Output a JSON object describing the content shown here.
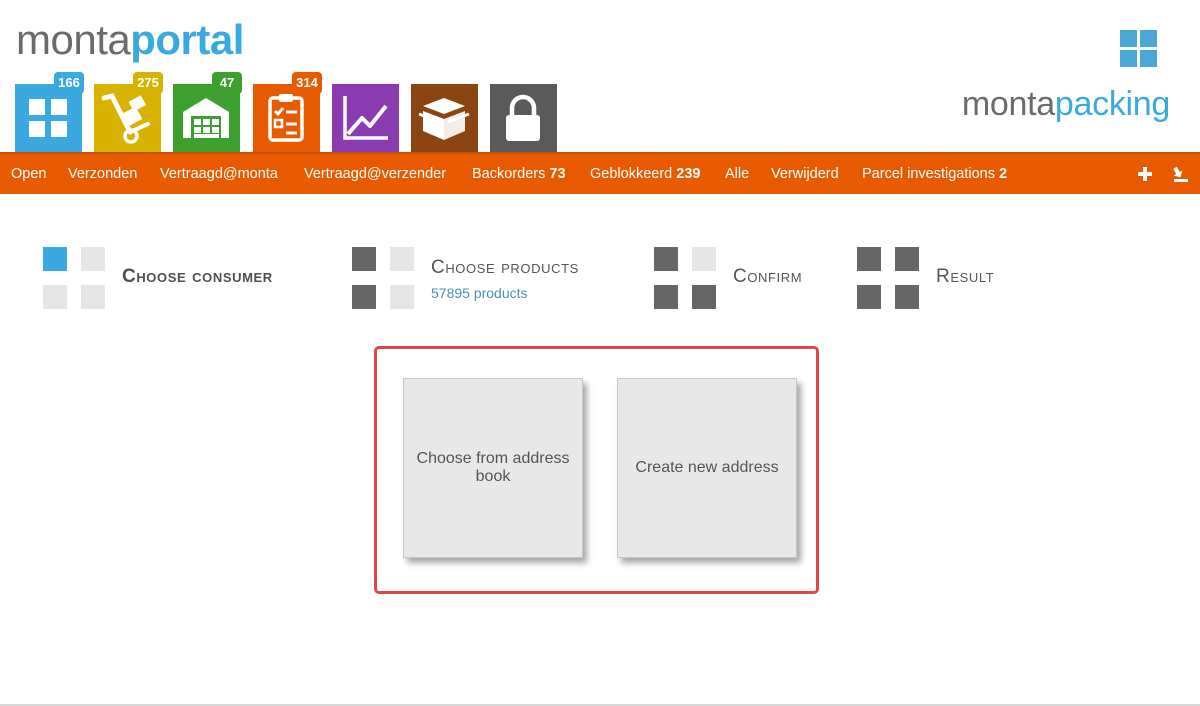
{
  "header": {
    "logo_left": {
      "part1": "monta",
      "part2": "portal"
    },
    "logo_right": {
      "part1": "monta",
      "part2": "packing"
    },
    "tiles": [
      {
        "name": "dashboard-tile",
        "icon": "grid-icon",
        "color": "#3aa9df",
        "badge": "166",
        "badge_color": "#3aa9df"
      },
      {
        "name": "shipping-tile",
        "icon": "hand-truck-icon",
        "color": "#d7b300",
        "badge": "275",
        "badge_color": "#d7b300"
      },
      {
        "name": "warehouse-tile",
        "icon": "warehouse-icon",
        "color": "#3ca02e",
        "badge": "47",
        "badge_color": "#3ca02e"
      },
      {
        "name": "orders-tile",
        "icon": "clipboard-checklist-icon",
        "color": "#e75a00",
        "badge": "314",
        "badge_color": "#e75a00"
      },
      {
        "name": "analytics-tile",
        "icon": "line-chart-icon",
        "color": "#8b3bb0",
        "badge": null,
        "badge_color": null
      },
      {
        "name": "packaging-tile",
        "icon": "open-box-icon",
        "color": "#8a4512",
        "badge": null,
        "badge_color": null
      },
      {
        "name": "lock-tile",
        "icon": "lock-icon",
        "color": "#5a5a5a",
        "badge": null,
        "badge_color": null
      }
    ]
  },
  "nav": {
    "items": [
      {
        "label": "Open",
        "count": ""
      },
      {
        "label": "Verzonden",
        "count": ""
      },
      {
        "label": "Vertraagd@monta",
        "count": ""
      },
      {
        "label": "Vertraagd@verzender",
        "count": ""
      },
      {
        "label": "Backorders",
        "count": "73"
      },
      {
        "label": "Geblokkeerd",
        "count": "239"
      },
      {
        "label": "Alle",
        "count": ""
      },
      {
        "label": "Verwijderd",
        "count": ""
      },
      {
        "label": "Parcel investigations",
        "count": "2"
      }
    ],
    "icons": [
      "plus-icon",
      "import-icon"
    ]
  },
  "wizard": {
    "steps": [
      {
        "title": "Choose consumer",
        "subtitle": "",
        "active": true
      },
      {
        "title": "Choose products",
        "subtitle": "57895 products",
        "active": false
      },
      {
        "title": "Confirm",
        "subtitle": "",
        "active": false
      },
      {
        "title": "Result",
        "subtitle": "",
        "active": false
      }
    ]
  },
  "options": {
    "address_book": "Choose from address book",
    "new_address": "Create new address"
  }
}
